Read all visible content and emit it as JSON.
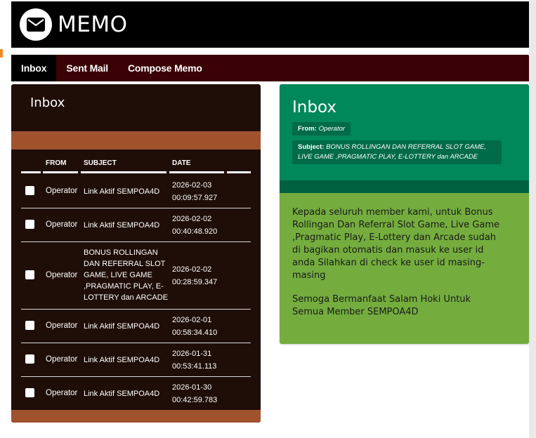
{
  "header": {
    "title": "MEMO",
    "icon": "envelope-icon"
  },
  "nav": {
    "items": [
      "Inbox",
      "Sent Mail",
      "Compose Memo"
    ],
    "active": "Inbox"
  },
  "inbox": {
    "title": "Inbox",
    "columns": {
      "from": "FROM",
      "subject": "SUBJECT",
      "date": "DATE"
    },
    "rows": [
      {
        "from": "Operator",
        "subject": "Link Aktif SEMPOA4D",
        "date": "2026-02-03",
        "time": "00:09:57.927"
      },
      {
        "from": "Operator",
        "subject": "Link Aktif SEMPOA4D",
        "date": "2026-02-02",
        "time": "00:40:48.920"
      },
      {
        "from": "Operator",
        "subject": "BONUS ROLLINGAN DAN REFERRAL SLOT GAME, LIVE GAME ,PRAGMATIC PLAY, E-LOTTERY dan ARCADE",
        "date": "2026-02-02",
        "time": "00:28:59.347"
      },
      {
        "from": "Operator",
        "subject": "Link Aktif SEMPOA4D",
        "date": "2026-02-01",
        "time": "00:58:34.410"
      },
      {
        "from": "Operator",
        "subject": "Link Aktif SEMPOA4D",
        "date": "2026-01-31",
        "time": "00:53:41.113"
      },
      {
        "from": "Operator",
        "subject": "Link Aktif SEMPOA4D",
        "date": "2026-01-30",
        "time": "00:42:59.783"
      }
    ]
  },
  "message": {
    "title": "Inbox",
    "from_key": "From:",
    "from_value": "Operator",
    "subject_key": "Subject:",
    "subject_value": "BONUS ROLLINGAN DAN REFERRAL SLOT GAME, LIVE GAME ,PRAGMATIC PLAY, E-LOTTERY dan ARCADE",
    "body_p1": "Kepada seluruh member kami, untuk Bonus Rollingan Dan Referral Slot Game, Live Game ,Pragmatic Play, E-Lottery dan Arcade sudah di bagikan otomatis dan masuk ke user id anda Silahkan di check ke user id masing-masing",
    "body_p2": "Semoga Bermanfaat  Salam Hoki Untuk Semua Member SEMPOA4D"
  },
  "colors": {
    "header_bg": "#000000",
    "nav_bg": "#3a0205",
    "inbox_bg": "#1f0e07",
    "accent_brown": "#a0522d",
    "msg_header": "#00875a",
    "msg_body": "#74ad3e"
  }
}
